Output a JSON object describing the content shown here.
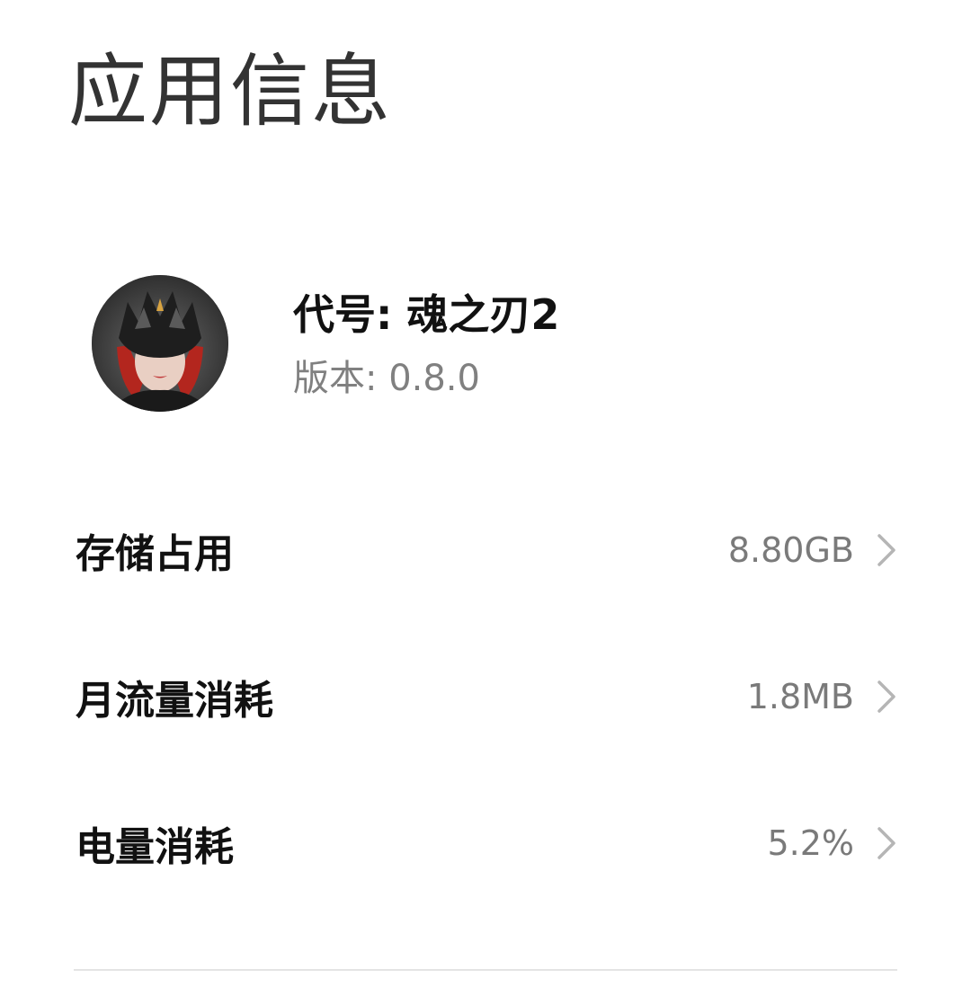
{
  "page": {
    "title": "应用信息"
  },
  "app": {
    "icon": "app-icon-dark-masked-character",
    "name": "代号: 魂之刃2",
    "version": "版本: 0.8.0"
  },
  "settings": {
    "items": [
      {
        "label": "存储占用",
        "value": "8.80GB",
        "icon": "chevron-right-icon"
      },
      {
        "label": "月流量消耗",
        "value": "1.8MB",
        "icon": "chevron-right-icon"
      },
      {
        "label": "电量消耗",
        "value": "5.2%",
        "icon": "chevron-right-icon"
      }
    ]
  },
  "colors": {
    "background": "#ffffff",
    "title": "#333333",
    "primary_text": "#111111",
    "secondary_text": "#7a7a7a",
    "chevron": "#b5b5b5",
    "divider": "#e4e4e4"
  }
}
